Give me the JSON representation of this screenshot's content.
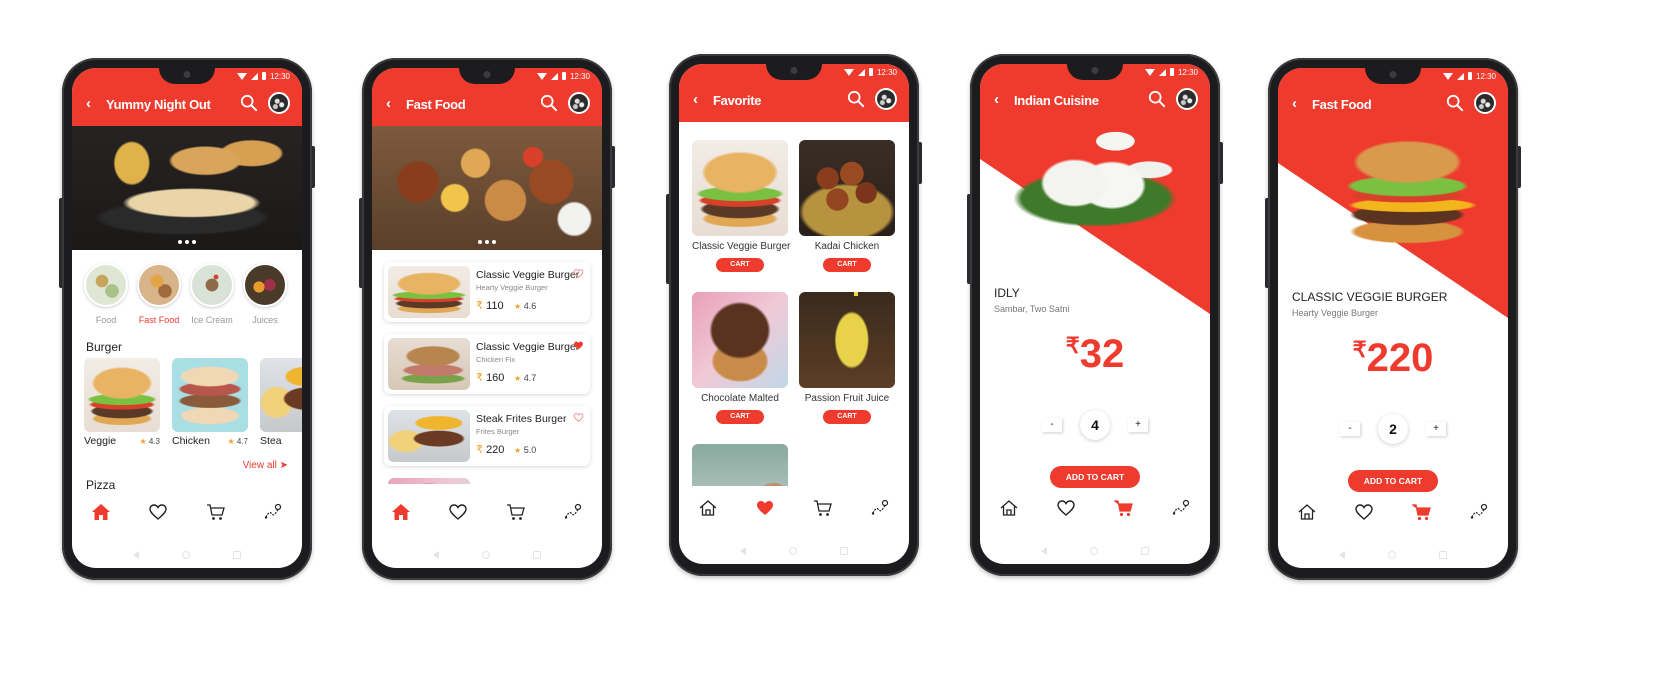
{
  "status_time": "12:30",
  "colors": {
    "accent": "#ef3a2e",
    "star": "#f0a22e"
  },
  "icons": {
    "back": "chevron-left-icon",
    "search": "search-icon",
    "avatar": "avatar",
    "home": "home-icon",
    "heart": "heart-icon",
    "cart": "cart-icon",
    "route": "route-icon"
  },
  "phone1": {
    "title": "Yummy Night Out",
    "categories": [
      {
        "label": "Food",
        "active": false
      },
      {
        "label": "Fast Food",
        "active": true
      },
      {
        "label": "Ice Cream",
        "active": false
      },
      {
        "label": "Juices",
        "active": false
      }
    ],
    "section_burger": "Burger",
    "burgers": [
      {
        "name": "Veggie",
        "rating": "4.3"
      },
      {
        "name": "Chicken",
        "rating": "4.7"
      },
      {
        "name": "Stea",
        "rating": ""
      }
    ],
    "view_all": "View all ➤",
    "section_pizza": "Pizza",
    "active_nav": "home"
  },
  "phone2": {
    "title": "Fast Food",
    "items": [
      {
        "name": "Classic Veggie Burger",
        "sub": "Hearty Veggie Burger",
        "price": "110",
        "rating": "4.6",
        "favorite": false
      },
      {
        "name": "Classic Veggie Burger",
        "sub": "Chicken Fix",
        "price": "160",
        "rating": "4.7",
        "favorite": true
      },
      {
        "name": "Steak Frites Burger",
        "sub": "Frites Burger",
        "price": "220",
        "rating": "5.0",
        "favorite": false
      }
    ],
    "currency": "₹",
    "active_nav": "home"
  },
  "phone3": {
    "title": "Favorite",
    "items": [
      {
        "name": "Classic Veggie Burger",
        "button": "CART"
      },
      {
        "name": "Kadai Chicken",
        "button": "CART"
      },
      {
        "name": "Chocolate Malted",
        "button": "CART"
      },
      {
        "name": "Passion Fruit Juice",
        "button": "CART"
      }
    ],
    "active_nav": "heart"
  },
  "phone4": {
    "title": "Indian Cuisine",
    "item_name": "IDLY",
    "item_sub": "Sambar, Two Satni",
    "currency": "₹",
    "price": "32",
    "minus": "-",
    "plus": "+",
    "quantity": "4",
    "add_to_cart": "ADD TO CART",
    "active_nav": "cart"
  },
  "phone5": {
    "title": "Fast Food",
    "item_name": "CLASSIC VEGGIE BURGER",
    "item_sub": "Hearty Veggie Burger",
    "currency": "₹",
    "price": "220",
    "minus": "-",
    "plus": "+",
    "quantity": "2",
    "add_to_cart": "ADD TO CART",
    "active_nav": "cart"
  }
}
